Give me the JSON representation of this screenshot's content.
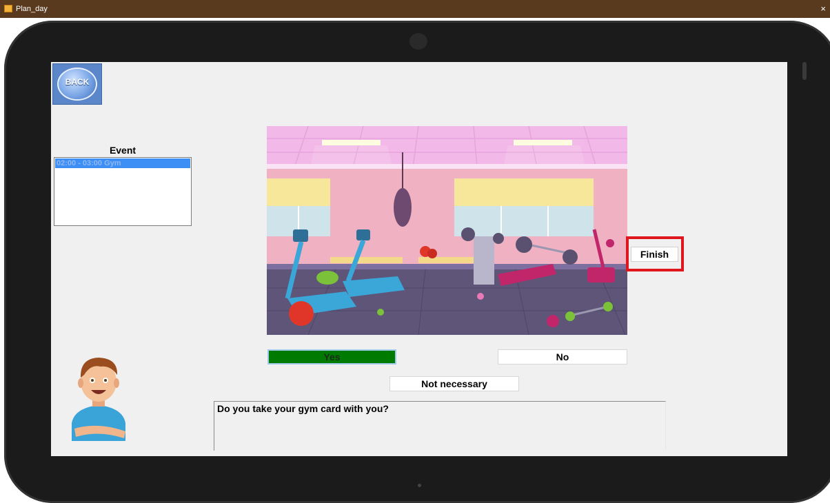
{
  "window": {
    "title": "Plan_day",
    "close_glyph": "×"
  },
  "back_button": {
    "label": "BACK",
    "icon": "back-arrow-icon"
  },
  "event_panel": {
    "label": "Event",
    "items": [
      {
        "text": "02:00 - 03:00  Gym",
        "selected": true
      }
    ]
  },
  "scene_image": {
    "depicts": "gym"
  },
  "answers": {
    "yes": "Yes",
    "no": "No",
    "not_necessary": "Not necessary"
  },
  "finish_button": {
    "label": "Finish"
  },
  "question": {
    "text": "Do you take your gym card with you?"
  },
  "colors": {
    "titlebar": "#5a3a1f",
    "yes_button": "#007a00",
    "selection": "#3d8ff5",
    "highlight_frame": "#e0161f"
  }
}
